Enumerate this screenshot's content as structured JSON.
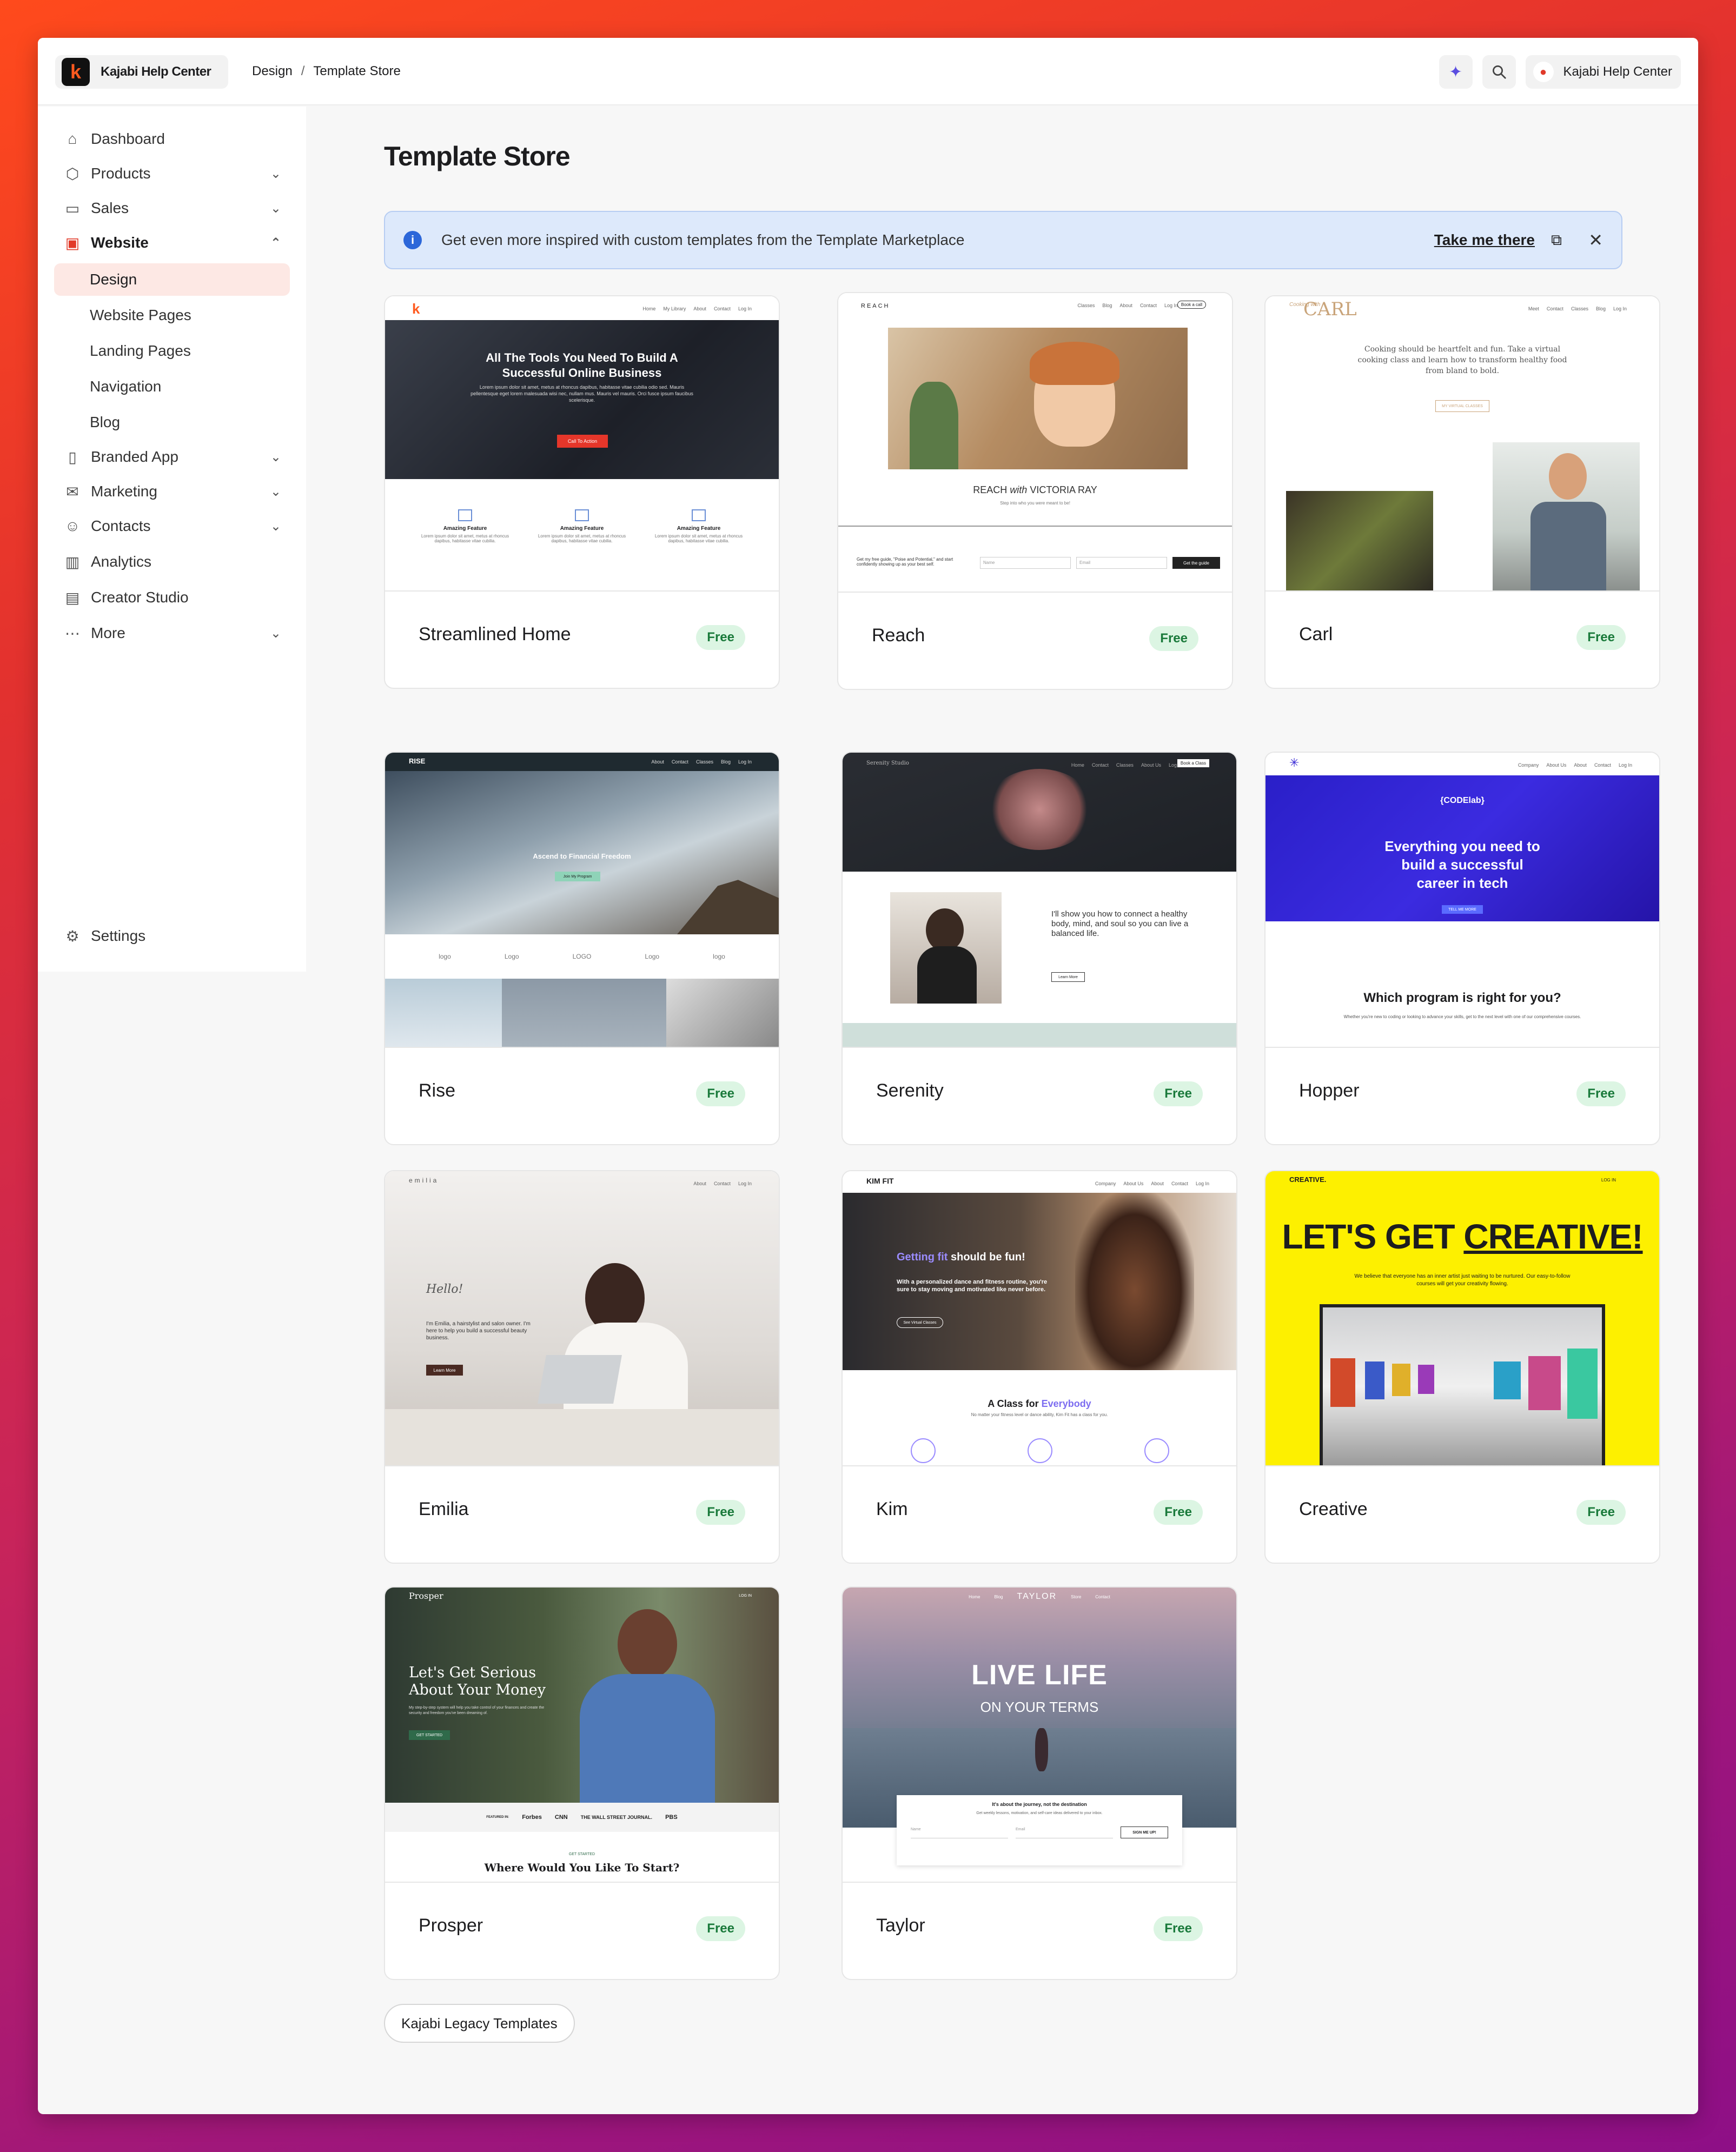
{
  "brand": {
    "name": "Kajabi Help Center",
    "logo_letter": "k"
  },
  "breadcrumb": [
    "Design",
    "Template Store"
  ],
  "top_actions": {
    "sparkle_icon": "sparkle-icon",
    "search_icon": "search-icon",
    "account_label": "Kajabi Help Center"
  },
  "sidebar": {
    "items": [
      {
        "label": "Dashboard",
        "icon": "home-icon"
      },
      {
        "label": "Products",
        "icon": "box-icon"
      },
      {
        "label": "Sales",
        "icon": "card-icon"
      },
      {
        "label": "Website",
        "icon": "monitor-icon"
      },
      {
        "label": "Design"
      },
      {
        "label": "Website Pages"
      },
      {
        "label": "Landing Pages"
      },
      {
        "label": "Navigation"
      },
      {
        "label": "Blog"
      },
      {
        "label": "Branded App",
        "icon": "phone-icon"
      },
      {
        "label": "Marketing",
        "icon": "mail-icon"
      },
      {
        "label": "Contacts",
        "icon": "users-icon"
      },
      {
        "label": "Analytics",
        "icon": "chart-icon"
      },
      {
        "label": "Creator Studio",
        "icon": "calendar-icon"
      },
      {
        "label": "More",
        "icon": "dots-icon"
      },
      {
        "label": "Settings",
        "icon": "gear-icon"
      }
    ]
  },
  "main": {
    "title": "Template Store",
    "banner": {
      "message": "Get even more inspired with custom templates from the Template Marketplace",
      "link": "Take me there"
    },
    "templates": [
      {
        "name": "Streamlined Home",
        "price": "Free"
      },
      {
        "name": "Reach",
        "price": "Free"
      },
      {
        "name": "Carl",
        "price": "Free"
      },
      {
        "name": "Rise",
        "price": "Free"
      },
      {
        "name": "Serenity",
        "price": "Free"
      },
      {
        "name": "Hopper",
        "price": "Free"
      },
      {
        "name": "Emilia",
        "price": "Free"
      },
      {
        "name": "Kim",
        "price": "Free"
      },
      {
        "name": "Creative",
        "price": "Free"
      },
      {
        "name": "Prosper",
        "price": "Free"
      },
      {
        "name": "Taylor",
        "price": "Free"
      }
    ],
    "legacy_button": "Kajabi Legacy Templates"
  },
  "previews": {
    "streamlined": {
      "headline": "All The Tools You Need To Build A Successful Online Business",
      "body": "Lorem ipsum dolor sit amet, metus at rhoncus dapibus, habitasse vitae cubilia odio sed. Mauris pellentesque eget lorem malesuada wisi nec, nullam mus. Mauris vel mauris. Orci fusce ipsum faucibus scelerisque.",
      "cta": "Call To Action",
      "nav": [
        "Home",
        "My Library",
        "About",
        "Contact",
        "Log In"
      ],
      "feature": "Amazing Feature",
      "feature_body": "Lorem ipsum dolor sit amet, metus at rhoncus dapibus, habitasse vitae cubilia."
    },
    "reach": {
      "logo": "REACH",
      "nav": [
        "Classes",
        "Blog",
        "About",
        "Contact",
        "Log In"
      ],
      "nav_button": "Book a call",
      "title_a": "REACH ",
      "title_b": "with",
      "title_c": " VICTORIA RAY",
      "subtitle": "Step into who you were meant to be!",
      "form_text": "Get my free guide, \"Poise and Potential,\" and start confidently showing up as your best self.",
      "name_ph": "Name",
      "email_ph": "Email",
      "form_button": "Get the guide"
    },
    "carl": {
      "logo_a": "Cooking with",
      "logo_b": "CARL",
      "nav": [
        "Meet",
        "Contact",
        "Classes",
        "Blog",
        "Log In"
      ],
      "tagline": "Cooking should be heartfelt and fun. Take a virtual cooking class and learn how to transform healthy food from bland to bold.",
      "cta": "MY VIRTUAL CLASSES"
    },
    "rise": {
      "logo": "RISE",
      "nav": [
        "About",
        "Contact",
        "Classes",
        "Blog",
        "Log In"
      ],
      "headline": "Ascend to Financial Freedom",
      "cta": "Join My Program",
      "logos": [
        "logo",
        "Logo",
        "LOGO"
      ]
    },
    "serenity": {
      "logo": "Serenity Studio",
      "nav": [
        "Home",
        "Contact",
        "Classes",
        "About Us",
        "Log In"
      ],
      "nav_button": "Book a Class",
      "text": "I'll show you how to connect a healthy body, mind, and soul so you can live a balanced life.",
      "cta": "Learn More"
    },
    "hopper": {
      "nav": [
        "Company",
        "About Us",
        "About",
        "Contact",
        "Log In"
      ],
      "badge": "{CODElab}",
      "headline": "Everything you need to build a successful career in tech",
      "cta": "TELL ME MORE",
      "section": "Which program is right for you?",
      "section_body": "Whether you're new to coding or looking to advance your skills, get to the next level with one of our comprehensive courses."
    },
    "emilia": {
      "logo": "emilia",
      "nav": [
        "About",
        "Contact",
        "Log In"
      ],
      "hello": "Hello!",
      "text": "I'm Emilia, a hairstylist and salon owner. I'm here to help you build a successful beauty business.",
      "cta": "Learn More"
    },
    "kim": {
      "logo": "KIM FIT",
      "nav": [
        "Company",
        "About Us",
        "About",
        "Contact",
        "Log In"
      ],
      "headline_a": "Getting fit",
      "headline_b": " should be fun!",
      "text": "With a personalized dance and fitness routine, you're sure to stay moving and motivated like never before.",
      "cta": "See Virtual Classes",
      "section_a": "A Class for ",
      "section_b": "Everybody",
      "section_body": "No matter your fitness level or dance ability, Kim Fit has a class for you."
    },
    "creative": {
      "logo": "CREATIVE.",
      "login": "LOG IN",
      "headline_a": "LET'S GET ",
      "headline_b": "CREATIVE!",
      "text": "We believe that everyone has an inner artist just waiting to be nurtured. Our easy-to-follow courses will get your creativity flowing."
    },
    "prosper": {
      "logo": "Prosper",
      "login": "LOG IN",
      "headline": "Let's Get Serious About Your Money",
      "text": "My step-by-step system will help you take control of your finances and create the security and freedom you've been dreaming of.",
      "cta": "GET STARTED",
      "featured": "FEATURED IN:",
      "logos": [
        "Forbes",
        "CNN",
        "THE WALL STREET JOURNAL.",
        "PBS"
      ],
      "section_kicker": "GET STARTED",
      "section": "Where Would You Like To Start?"
    },
    "taylor": {
      "nav_left": [
        "Home",
        "Blog"
      ],
      "logo": "TAYLOR",
      "nav_right": [
        "Store",
        "Contact"
      ],
      "headline": "LIVE LIFE",
      "sub": "ON YOUR TERMS",
      "form_title": "It's about the journey, not the destination",
      "form_body": "Get weekly lessons, motivation, and self-care ideas delivered to your inbox.",
      "name_ph": "Name",
      "email_ph": "Email",
      "form_button": "SIGN ME UP!"
    }
  }
}
